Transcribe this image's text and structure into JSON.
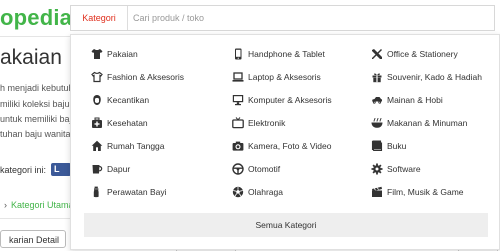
{
  "background": {
    "logo_text": "opedia",
    "page_title": "akaian",
    "body_lines": [
      "h menjadi kebutuh",
      "miliki koleksi baju wa",
      "untuk memiliki baju",
      "tuhan baju wanita"
    ],
    "share_label": "kategori ini:",
    "fb_label": "L",
    "breadcrumb_label": "Kategori Utama",
    "detail_button": "karian Detail"
  },
  "search": {
    "category_tab": "Kategori",
    "placeholder": "Cari produk / toko"
  },
  "categories": [
    {
      "label": "Pakaian",
      "icon": "shirt-icon"
    },
    {
      "label": "Handphone & Tablet",
      "icon": "phone-icon"
    },
    {
      "label": "Office & Stationery",
      "icon": "stationery-icon"
    },
    {
      "label": "Fashion & Aksesoris",
      "icon": "tshirt-icon"
    },
    {
      "label": "Laptop & Aksesoris",
      "icon": "laptop-icon"
    },
    {
      "label": "Souvenir, Kado & Hadiah",
      "icon": "gift-icon"
    },
    {
      "label": "Kecantikan",
      "icon": "beauty-icon"
    },
    {
      "label": "Komputer & Aksesoris",
      "icon": "computer-icon"
    },
    {
      "label": "Mainan & Hobi",
      "icon": "toy-car-icon"
    },
    {
      "label": "Kesehatan",
      "icon": "health-kit-icon"
    },
    {
      "label": "Elektronik",
      "icon": "tv-icon"
    },
    {
      "label": "Makanan & Minuman",
      "icon": "food-icon"
    },
    {
      "label": "Rumah Tangga",
      "icon": "house-icon"
    },
    {
      "label": "Kamera, Foto & Video",
      "icon": "camera-icon"
    },
    {
      "label": "Buku",
      "icon": "book-icon"
    },
    {
      "label": "Dapur",
      "icon": "cup-icon"
    },
    {
      "label": "Otomotif",
      "icon": "wheel-icon"
    },
    {
      "label": "Software",
      "icon": "gear-icon"
    },
    {
      "label": "Perawatan Bayi",
      "icon": "baby-icon"
    },
    {
      "label": "Olahraga",
      "icon": "ball-icon"
    },
    {
      "label": "Film, Musik & Game",
      "icon": "film-icon"
    }
  ],
  "footer_label": "Semua Kategori",
  "colors": {
    "brand_green": "#42b549",
    "accent_red": "#e0301e",
    "icon_dark": "#333333"
  }
}
